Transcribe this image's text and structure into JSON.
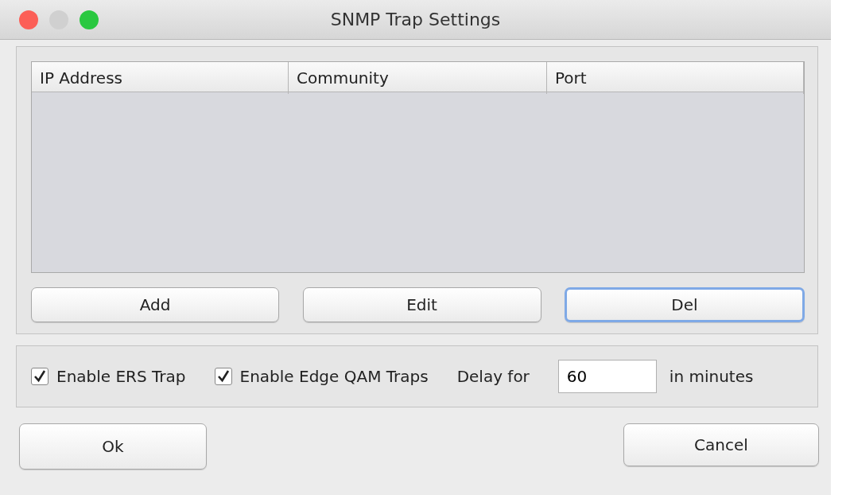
{
  "window": {
    "title": "SNMP Trap Settings",
    "controls": [
      {
        "color": "#fc5f57"
      },
      {
        "color": "#d0d0d0"
      },
      {
        "color": "#2ac840"
      }
    ]
  },
  "table": {
    "columns": [
      "IP Address",
      "Community",
      "Port"
    ]
  },
  "table_buttons": [
    {
      "label": "Add",
      "focused": false
    },
    {
      "label": "Edit",
      "focused": false
    },
    {
      "label": "Del",
      "focused": true
    }
  ],
  "options": {
    "checkboxes": [
      {
        "label": "Enable ERS Trap",
        "checked": true
      },
      {
        "label": "Enable Edge QAM Traps",
        "checked": true
      }
    ],
    "delay_label": "Delay for",
    "delay_value": "60",
    "unit_label": "in minutes"
  },
  "footer_buttons": [
    {
      "label": "Ok",
      "focused": false
    },
    {
      "label": "Cancel",
      "focused": false
    }
  ]
}
